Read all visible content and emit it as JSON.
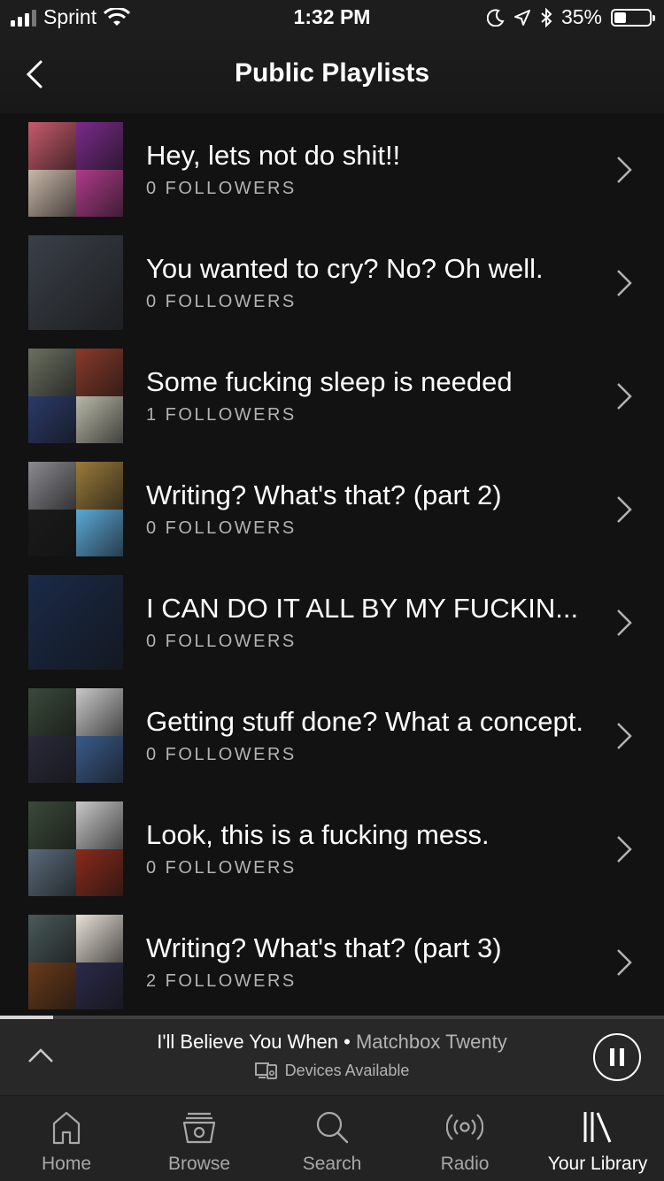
{
  "status_bar": {
    "carrier": "Sprint",
    "time": "1:32 PM",
    "battery": "35%",
    "battery_level": 0.35,
    "signal_bars": 3
  },
  "nav": {
    "title": "Public Playlists"
  },
  "playlists": [
    {
      "title": "Hey, lets not do shit!!",
      "followers": "0 FOLLOWERS",
      "colors": [
        "#c85a6a",
        "#7a2a8a",
        "#c9b7a8",
        "#b03a8a"
      ]
    },
    {
      "title": "You wanted to cry? No? Oh well.",
      "followers": "0 FOLLOWERS",
      "colors": [
        "#3a4048"
      ]
    },
    {
      "title": "Some fucking sleep is needed",
      "followers": "1 FOLLOWERS",
      "colors": [
        "#6a7060",
        "#8a3a2a",
        "#2a3a6a",
        "#b8b8a8"
      ]
    },
    {
      "title": "Writing? What's that? (part 2)",
      "followers": "0 FOLLOWERS",
      "colors": [
        "#8a8a90",
        "#9a7a3a",
        "#1a1a1a",
        "#5aa8d8"
      ]
    },
    {
      "title": "I CAN DO IT ALL BY MY FUCKIN...",
      "followers": "0 FOLLOWERS",
      "colors": [
        "#1a2a48"
      ]
    },
    {
      "title": "Getting stuff done? What a concept.",
      "followers": "0 FOLLOWERS",
      "colors": [
        "#3a4a3a",
        "#c8c8c8",
        "#2a2a3a",
        "#3a5a8a"
      ]
    },
    {
      "title": "Look, this is a fucking mess.",
      "followers": "0 FOLLOWERS",
      "colors": [
        "#3a4a3a",
        "#c8c8c8",
        "#5a6a7a",
        "#8a2a1a"
      ]
    },
    {
      "title": "Writing? What's that? (part 3)",
      "followers": "2 FOLLOWERS",
      "colors": [
        "#4a5a5a",
        "#e8e0d8",
        "#6a3a1a",
        "#2a2a4a"
      ]
    }
  ],
  "now_playing": {
    "track": "I'll Believe You When",
    "separator": "•",
    "artist": "Matchbox Twenty",
    "devices": "Devices Available",
    "progress": 0.08
  },
  "tabs": [
    {
      "label": "Home",
      "icon": "home-icon"
    },
    {
      "label": "Browse",
      "icon": "browse-icon"
    },
    {
      "label": "Search",
      "icon": "search-icon"
    },
    {
      "label": "Radio",
      "icon": "radio-icon"
    },
    {
      "label": "Your Library",
      "icon": "library-icon"
    }
  ],
  "active_tab": "Your Library"
}
